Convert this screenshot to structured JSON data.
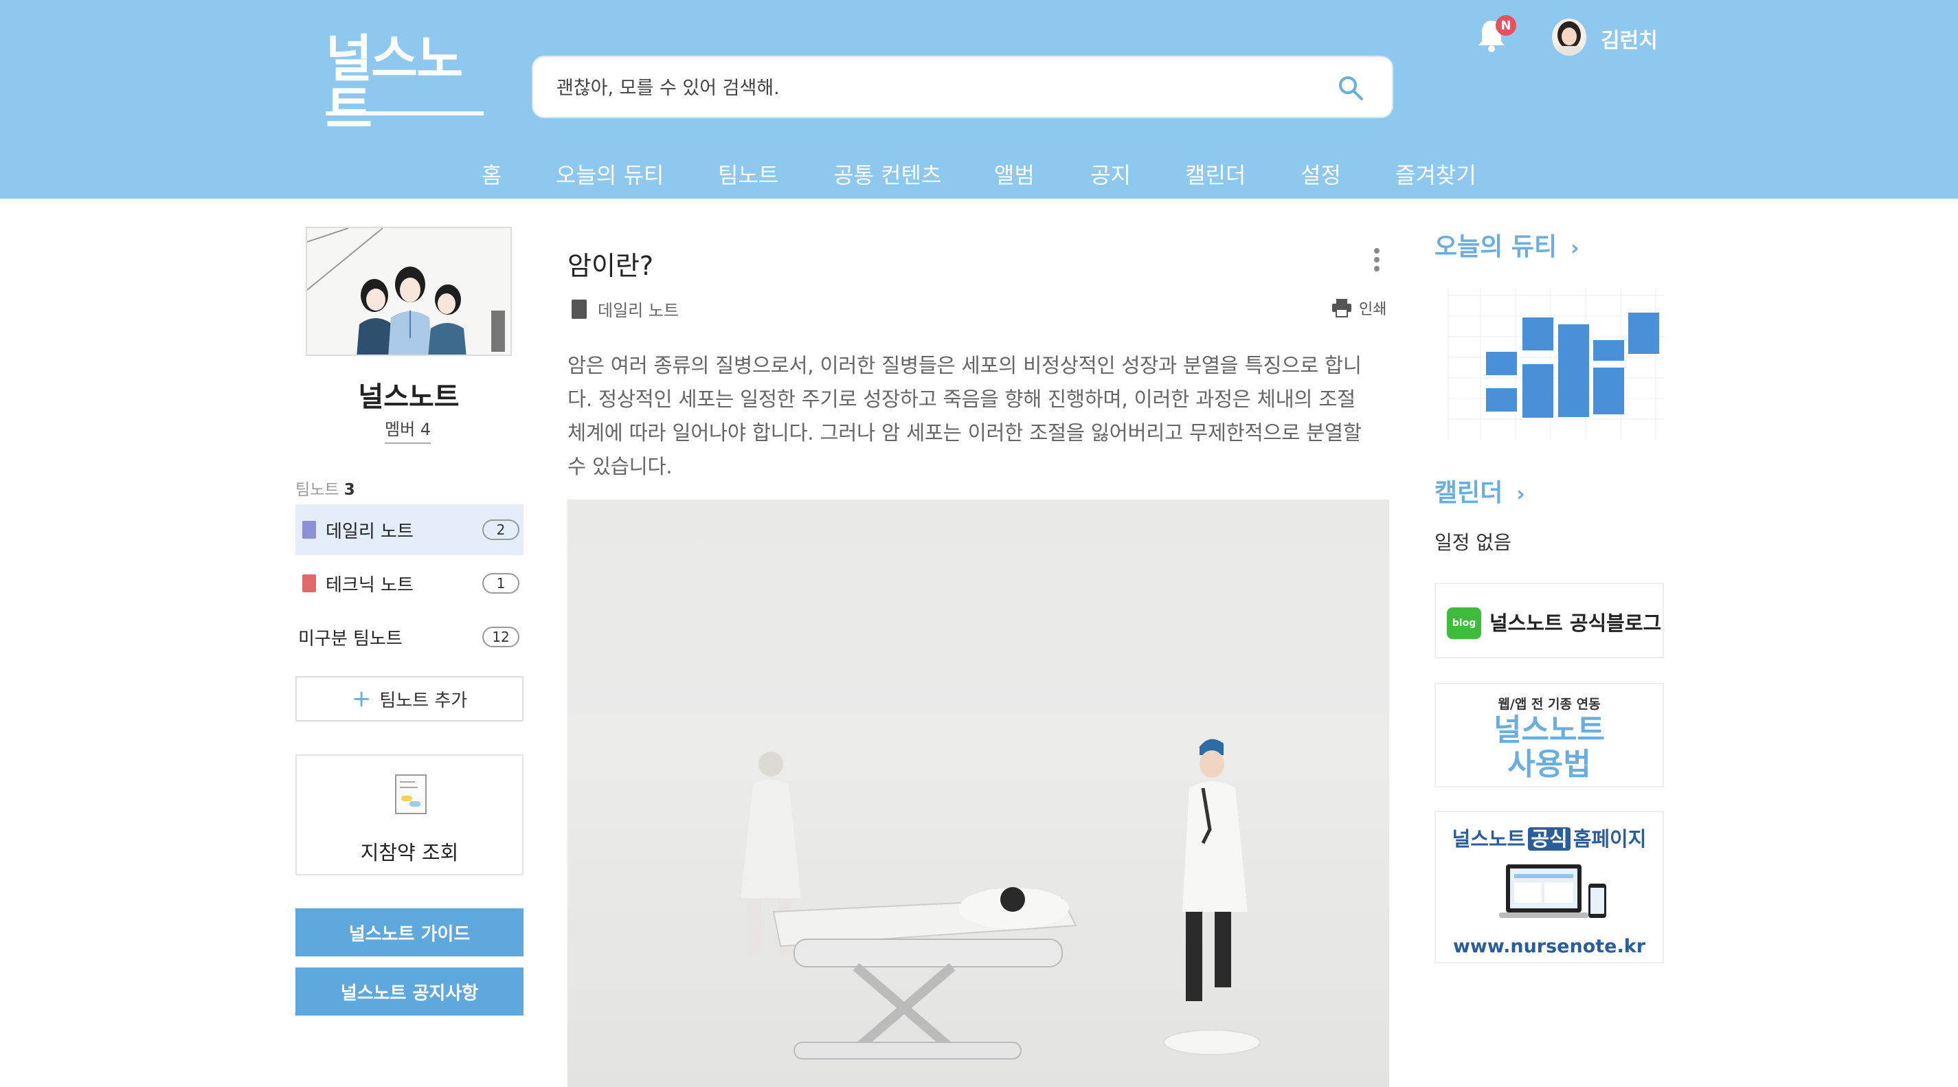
{
  "header": {
    "logo_text": "널스노트",
    "search_placeholder": "괜찮아, 모를 수 있어 검색해.",
    "notification_badge": "N",
    "username": "김런치",
    "nav": [
      "홈",
      "오늘의 듀티",
      "팀노트",
      "공통 컨텐츠",
      "앨범",
      "공지",
      "캘린더",
      "설정",
      "즐겨찾기"
    ]
  },
  "sidebar": {
    "team_name": "널스노트",
    "member_label": "멤버 4",
    "teamnote_label": "팀노트",
    "teamnote_count": "3",
    "notes": [
      {
        "label": "데일리 노트",
        "count": "2",
        "color": "#8a8fd6"
      },
      {
        "label": "테크닉 노트",
        "count": "1",
        "color": "#e06a6a"
      },
      {
        "label": "미구분 팀노트",
        "count": "12"
      }
    ],
    "add_button": "팀노트 추가",
    "drug_lookup": "지참약 조회",
    "guide_button": "널스노트 가이드",
    "notice_button": "널스노트 공지사항"
  },
  "article": {
    "title": "암이란?",
    "category": "데일리 노트",
    "print_label": "인쇄",
    "body_lines": [
      "암은 여러 종류의 질병으로서, 이러한 질병들은 세포의 비정상적인 성장과 분열을 특징으로 합니",
      "다. 정상적인 세포는 일정한 주기로 성장하고 죽음을 향해 진행하며, 이러한 과정은 체내의 조절",
      "체계에 따라 일어나야 합니다. 그러나 암 세포는 이러한 조절을 잃어버리고 무제한적으로 분열할",
      "수 있습니다."
    ]
  },
  "right": {
    "duty_heading": "오늘의 듀티",
    "calendar_heading": "캘린더",
    "no_schedule": "일정 없음",
    "blog_label": "널스노트 공식블로그",
    "blog_icon_text": "blog",
    "usage_sub": "웹/앱 전 기종 연동",
    "usage_title_1": "널스노트",
    "usage_title_2": "사용법",
    "home_title_a": "널스노트",
    "home_title_b": "공식",
    "home_title_c": "홈페이지",
    "home_url": "www.nursenote.kr"
  },
  "colors": {
    "header_bg": "#8ec8ef",
    "accent": "#6aaee0",
    "button": "#5fa8dd"
  }
}
